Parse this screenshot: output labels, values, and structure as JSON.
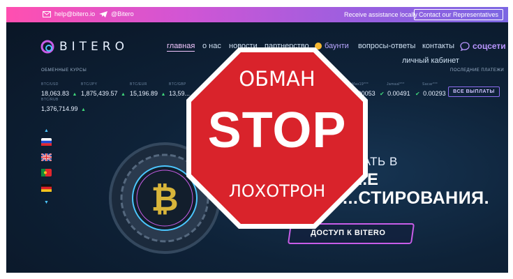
{
  "topbar": {
    "email": "help@bitero.io",
    "telegram": "@Bitero",
    "assistance": "Receive assistance locally",
    "contact_button": "Contact our Representatives"
  },
  "logo": {
    "text": "BITERO"
  },
  "nav": {
    "items": [
      "главная",
      "о нас",
      "новости",
      "партнерство",
      "баунти",
      "вопросы-ответы",
      "контакты"
    ],
    "cabinet": "личный кабинет",
    "social": "соцсети"
  },
  "labels": {
    "rates": "ОБМЕННЫЕ КУРСЫ",
    "payments": "ПОСЛЕДНИЕ ПЛАТЕЖИ",
    "all_payouts": "ВСЕ ВЫПЛАТЫ"
  },
  "rates": [
    {
      "name": "BTC/USD",
      "value": "18,063.83"
    },
    {
      "name": "BTC/JPY",
      "value": "1,875,439.57"
    },
    {
      "name": "BTC/EUR",
      "value": "15,196.89"
    },
    {
      "name": "BTC/GBP",
      "value": "13,59..."
    },
    {
      "name": "BTC/RUB",
      "value": "1,376,714.99"
    }
  ],
  "payments": [
    {
      "name": "Mas19***",
      "value": "0.00053"
    },
    {
      "name": "Jamaal***",
      "value": "0.00491"
    },
    {
      "name": "Sacar***",
      "value": "0.00293"
    }
  ],
  "flags": [
    "ru",
    "uk",
    "pt",
    "de"
  ],
  "hero": {
    "line1": "...ОВАТЬ В",
    "line2": "...Е",
    "line3": "...СТИРОВАНИЯ.",
    "cta": "ДОСТУП К BITERO"
  },
  "stop_sign": {
    "top": "ОБМАН",
    "main": "STOP",
    "bottom": "ЛОХОТРОН",
    "color": "#d9232b"
  },
  "colors": {
    "accent": "#c85de8",
    "up": "#3fd67a"
  }
}
